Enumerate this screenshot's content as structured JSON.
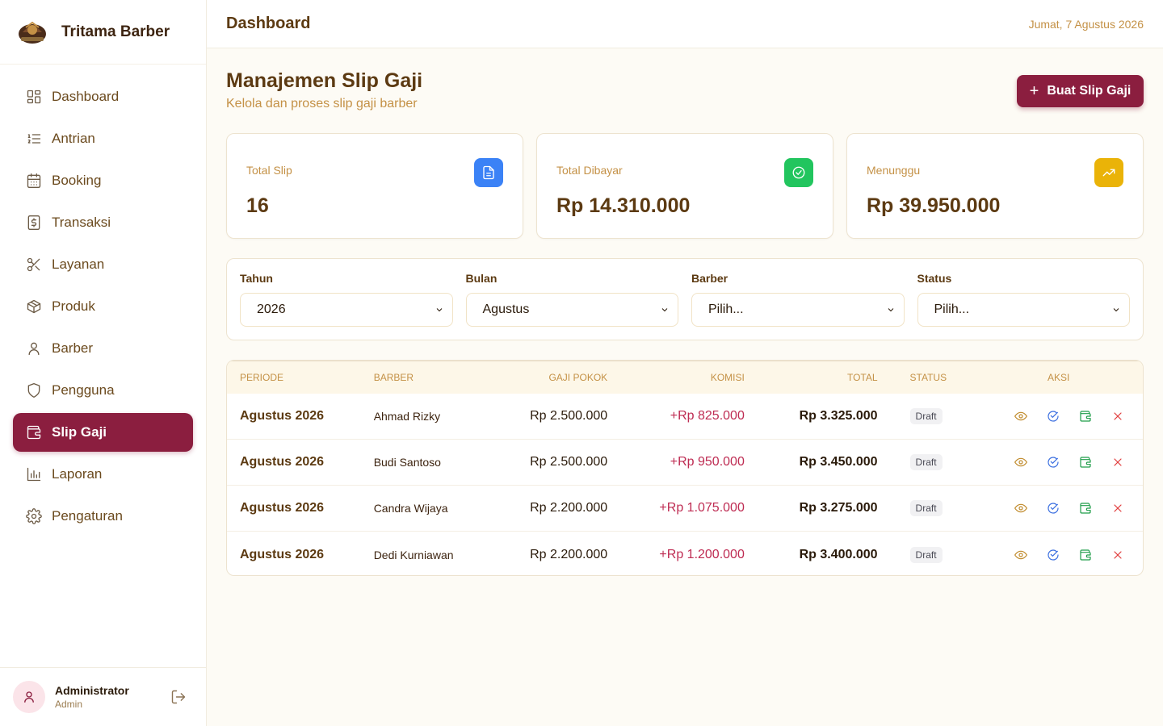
{
  "brand": {
    "name": "Tritama Barber"
  },
  "sidebar": {
    "items": [
      {
        "label": "Dashboard",
        "icon": "dashboard-icon"
      },
      {
        "label": "Antrian",
        "icon": "list-ordered-icon"
      },
      {
        "label": "Booking",
        "icon": "calendar-icon"
      },
      {
        "label": "Transaksi",
        "icon": "receipt-dollar-icon"
      },
      {
        "label": "Layanan",
        "icon": "scissors-icon"
      },
      {
        "label": "Produk",
        "icon": "box-icon"
      },
      {
        "label": "Barber",
        "icon": "user-icon"
      },
      {
        "label": "Pengguna",
        "icon": "shield-icon"
      },
      {
        "label": "Slip Gaji",
        "icon": "wallet-icon",
        "active": true
      },
      {
        "label": "Laporan",
        "icon": "bar-chart-icon"
      },
      {
        "label": "Pengaturan",
        "icon": "gear-icon"
      }
    ]
  },
  "user": {
    "name": "Administrator",
    "role": "Admin"
  },
  "topbar": {
    "title": "Dashboard",
    "date": "Jumat, 7 Agustus 2026"
  },
  "page": {
    "title": "Manajemen Slip Gaji",
    "subtitle": "Kelola dan proses slip gaji barber",
    "create_button": "Buat Slip Gaji"
  },
  "stats": [
    {
      "label": "Total Slip",
      "value": "16",
      "icon": "document-icon",
      "color": "#3b82f6"
    },
    {
      "label": "Total Dibayar",
      "value": "Rp 14.310.000",
      "icon": "check-circle-icon",
      "color": "#22c55e"
    },
    {
      "label": "Menunggu",
      "value": "Rp 39.950.000",
      "icon": "trending-up-icon",
      "color": "#eab308"
    }
  ],
  "filters": [
    {
      "label": "Tahun",
      "value": "2026"
    },
    {
      "label": "Bulan",
      "value": "Agustus"
    },
    {
      "label": "Barber",
      "value": "Pilih..."
    },
    {
      "label": "Status",
      "value": "Pilih..."
    }
  ],
  "table": {
    "headers": [
      "PERIODE",
      "BARBER",
      "GAJI POKOK",
      "KOMISI",
      "TOTAL",
      "STATUS",
      "AKSI"
    ],
    "rows": [
      {
        "periode": "Agustus 2026",
        "barber": "Ahmad Rizky",
        "gaji": "Rp 2.500.000",
        "komisi": "+Rp 825.000",
        "total": "Rp 3.325.000",
        "status": "Draft"
      },
      {
        "periode": "Agustus 2026",
        "barber": "Budi Santoso",
        "gaji": "Rp 2.500.000",
        "komisi": "+Rp 950.000",
        "total": "Rp 3.450.000",
        "status": "Draft"
      },
      {
        "periode": "Agustus 2026",
        "barber": "Candra Wijaya",
        "gaji": "Rp 2.200.000",
        "komisi": "+Rp 1.075.000",
        "total": "Rp 3.275.000",
        "status": "Draft"
      },
      {
        "periode": "Agustus 2026",
        "barber": "Dedi Kurniawan",
        "gaji": "Rp 2.200.000",
        "komisi": "+Rp 1.200.000",
        "total": "Rp 3.400.000",
        "status": "Draft"
      }
    ]
  },
  "colors": {
    "primary": "#8b1e3f",
    "accent_text": "#c49146",
    "heading": "#5c3a12"
  }
}
